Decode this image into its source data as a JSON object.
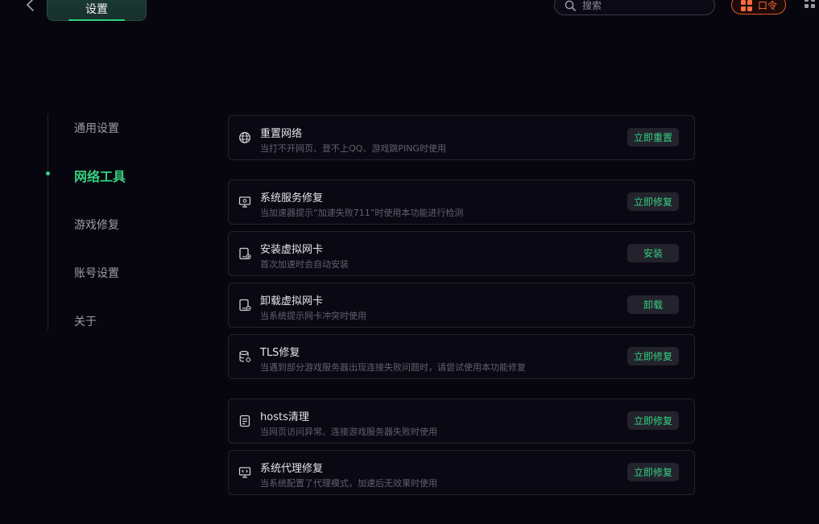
{
  "header": {
    "active_tab": "设置",
    "search_placeholder": "搜索",
    "code_button": "口令"
  },
  "sidebar": {
    "items": [
      {
        "label": "通用设置"
      },
      {
        "label": "网络工具"
      },
      {
        "label": "游戏修复"
      },
      {
        "label": "账号设置"
      },
      {
        "label": "关于"
      }
    ],
    "active": "网络工具"
  },
  "tools": [
    {
      "icon": "globe-icon",
      "title": "重置网络",
      "desc": "当打不开网页、登不上QQ、游戏跳PING时使用",
      "button": "立即重置"
    },
    {
      "icon": "monitor-gear-icon",
      "title": "系统服务修复",
      "desc": "当加速器提示“加速失败711”时使用本功能进行检测",
      "button": "立即修复"
    },
    {
      "icon": "network-card-icon",
      "title": "安装虚拟网卡",
      "desc": "首次加速时会自动安装",
      "button": "安装"
    },
    {
      "icon": "network-card-remove-icon",
      "title": "卸载虚拟网卡",
      "desc": "当系统提示网卡冲突时使用",
      "button": "卸载"
    },
    {
      "icon": "database-gear-icon",
      "title": "TLS修复",
      "desc": "当遇到部分游戏服务器出现连接失败问题时，请尝试使用本功能修复",
      "button": "立即修复"
    },
    {
      "icon": "hosts-file-icon",
      "title": "hosts清理",
      "desc": "当网页访问异常、连接游戏服务器失败时使用",
      "button": "立即修复"
    },
    {
      "icon": "monitor-code-icon",
      "title": "系统代理修复",
      "desc": "当系统配置了代理模式，加速后无效果时使用",
      "button": "立即修复"
    }
  ],
  "colors": {
    "accent": "#35d07f",
    "background": "#07060f",
    "code_button": "#ff6b3a"
  }
}
